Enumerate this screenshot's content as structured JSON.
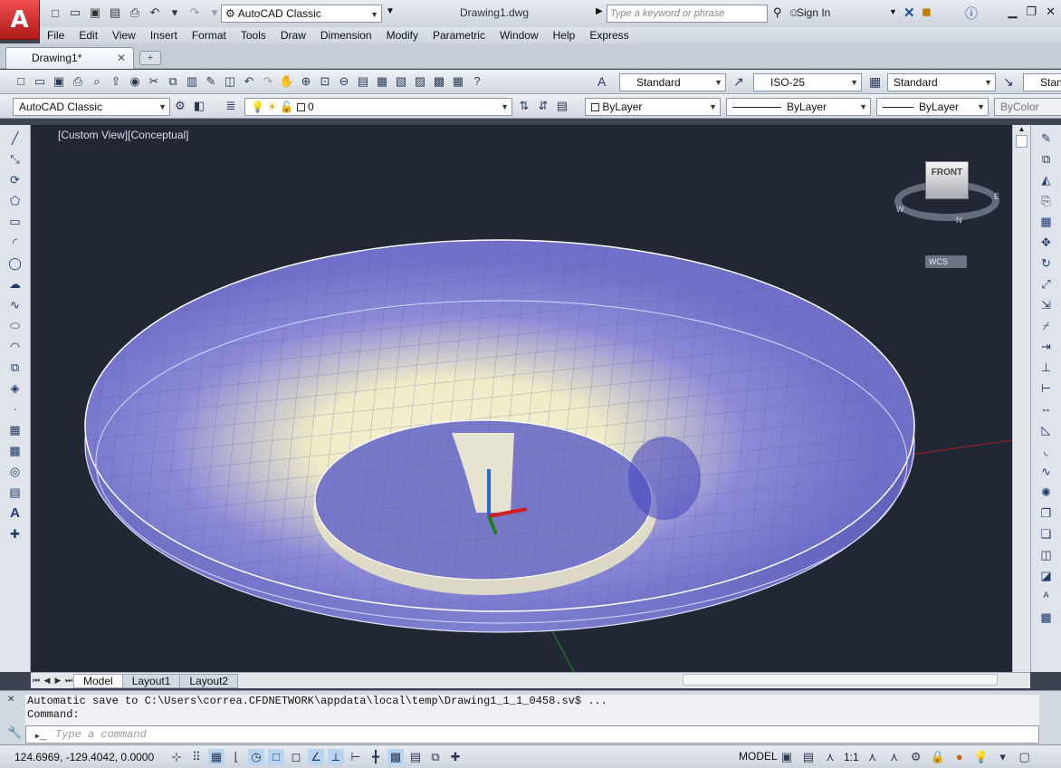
{
  "titlebar": {
    "logo": "A",
    "workspace": "AutoCAD Classic",
    "doc_title": "Drawing1.dwg",
    "search_placeholder": "Type a keyword or phrase",
    "signin": "Sign In"
  },
  "menu": [
    "File",
    "Edit",
    "View",
    "Insert",
    "Format",
    "Tools",
    "Draw",
    "Dimension",
    "Modify",
    "Parametric",
    "Window",
    "Help",
    "Express"
  ],
  "tabs": {
    "active": "Drawing1*"
  },
  "styles_toolbar": {
    "text_style": "Standard",
    "dim_style": "ISO-25",
    "table_style": "Standard",
    "multileader_style": "Stan"
  },
  "layers_toolbar": {
    "workspace": "AutoCAD Classic",
    "layer": "0",
    "color": "ByLayer",
    "linetype": "ByLayer",
    "lineweight": "ByLayer",
    "plotstyle": "ByColor"
  },
  "viewport": {
    "label": "[Custom View][Conceptual]",
    "viewcube_face": "FRONT",
    "ucs_label": "WCS",
    "compass": [
      "N",
      "E",
      "W"
    ]
  },
  "layouts": [
    "Model",
    "Layout1",
    "Layout2"
  ],
  "command": {
    "history": [
      "Automatic save to C:\\Users\\correa.CFDNETWORK\\appdata\\local\\temp\\Drawing1_1_1_0458.sv$ ...",
      "Command:"
    ],
    "placeholder": "Type a command"
  },
  "status": {
    "coords": "124.6969, -129.4042, 0.0000",
    "model": "MODEL",
    "scale": "1:1"
  }
}
